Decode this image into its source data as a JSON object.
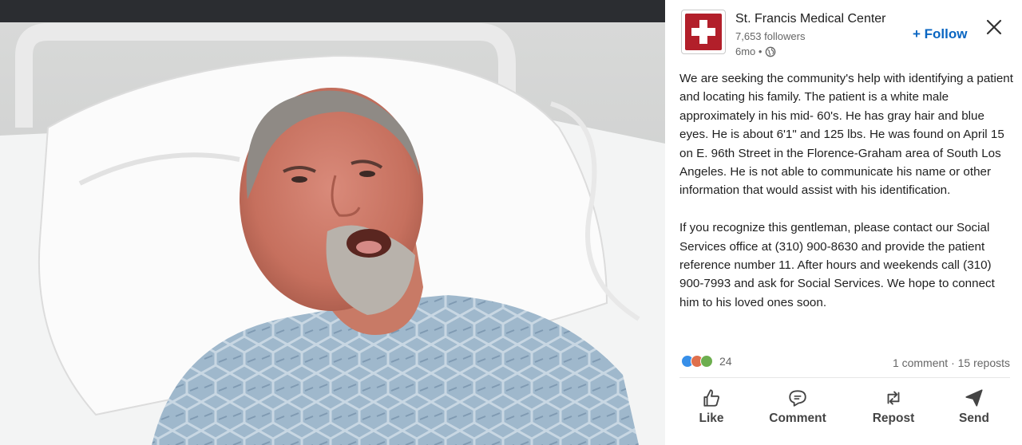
{
  "post": {
    "org_name": "St. Francis Medical Center",
    "followers": "7,653 followers",
    "time": "6mo •",
    "follow_label": "+ Follow",
    "paragraphs": [
      "We are seeking the community's help with identifying a patient and locating his family. The patient is a white male approximately in his mid- 60's. He has gray hair and blue eyes. He is about 6'1\" and 125 lbs. He was found on April 15 on E. 96th Street in the Florence-Graham area of South Los Angeles. He is not able to communicate his name or other information that would assist with his identification.",
      "If you recognize this gentleman, please contact our Social Services office at (310) 900-8630 and provide the patient reference number 11. After hours and weekends call (310) 900-7993 and ask for Social Services. We hope to connect him to his loved ones soon."
    ],
    "reaction_count": "24",
    "stats": "1 comment · 15 reposts"
  },
  "actions": {
    "like": "Like",
    "comment": "Comment",
    "repost": "Repost",
    "send": "Send"
  },
  "icons": {
    "logo": "medical-cross-logo",
    "close": "close-icon",
    "globe": "globe-icon",
    "like": "thumbs-up-icon",
    "comment": "comment-bubble-icon",
    "repost": "repost-arrows-icon",
    "send": "send-plane-icon"
  },
  "colors": {
    "brand_red": "#b21f2a",
    "link_blue": "#0a66c2"
  }
}
